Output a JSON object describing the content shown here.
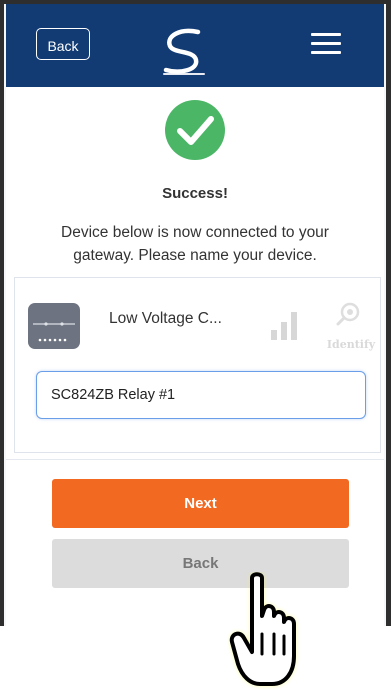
{
  "header": {
    "back_label": "Back",
    "logo_icon": "brand-swirl-logo-icon",
    "menu_icon": "hamburger-menu-icon",
    "background_color": "#123a73"
  },
  "success": {
    "icon": "checkmark-circle-icon",
    "icon_color": "#4cb667",
    "title": "Success!",
    "message": "Device below is now connected to your gateway. Please name your device."
  },
  "device": {
    "icon": "relay-device-icon",
    "name": "Low Voltage C...",
    "signal_icon": "signal-strength-icon",
    "identify_icon": "identify-magnifier-icon",
    "identify_label": "Identify",
    "name_input_value": "SC824ZB Relay #1"
  },
  "actions": {
    "next_label": "Next",
    "back_label": "Back",
    "next_color": "#f26a22",
    "back_color": "#dcdcdc"
  },
  "cursor": {
    "icon": "pointing-hand-cursor-icon"
  }
}
